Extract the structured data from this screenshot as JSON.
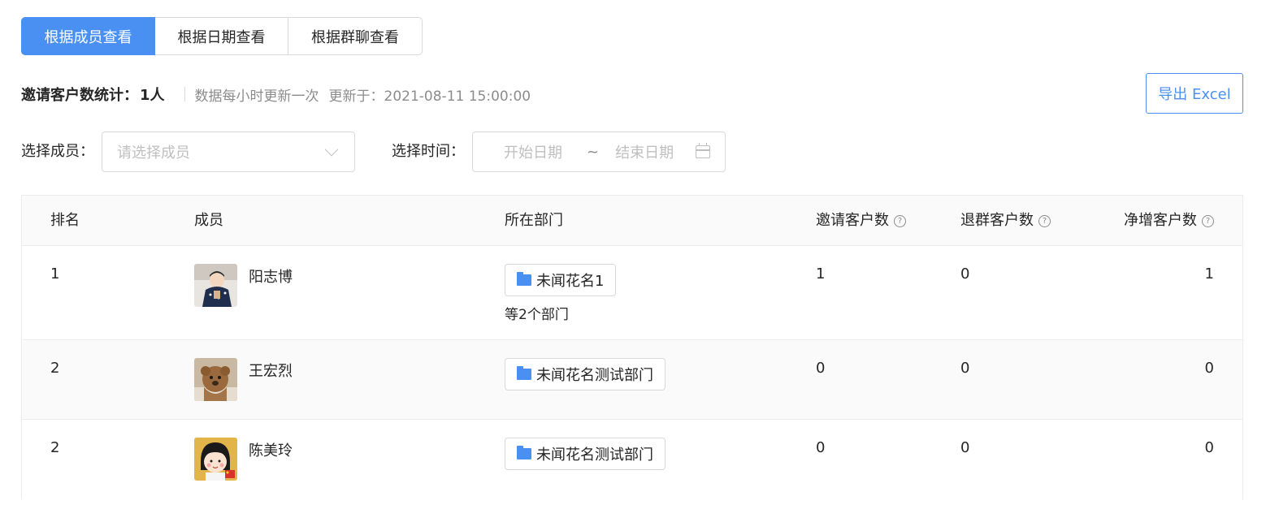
{
  "tabs": [
    {
      "label": "根据成员查看",
      "active": true
    },
    {
      "label": "根据日期查看",
      "active": false
    },
    {
      "label": "根据群聊查看",
      "active": false
    }
  ],
  "stats": {
    "label": "邀请客户数统计：",
    "value": "1人",
    "note": "数据每小时更新一次",
    "updated": "更新于：2021-08-11 15:00:00"
  },
  "export_button": "导出 Excel",
  "filters": {
    "member_label": "选择成员：",
    "member_placeholder": "请选择成员",
    "time_label": "选择时间：",
    "start_placeholder": "开始日期",
    "separator": "~",
    "end_placeholder": "结束日期"
  },
  "table": {
    "headers": {
      "rank": "排名",
      "member": "成员",
      "department": "所在部门",
      "invited": "邀请客户数",
      "left": "退群客户数",
      "net": "净增客户数"
    },
    "rows": [
      {
        "rank": "1",
        "name": "阳志博",
        "department": "未闻花名1",
        "department_more": "等2个部门",
        "invited": "1",
        "left": "0",
        "net": "1"
      },
      {
        "rank": "2",
        "name": "王宏烈",
        "department": "未闻花名测试部门",
        "department_more": "",
        "invited": "0",
        "left": "0",
        "net": "0"
      },
      {
        "rank": "2",
        "name": "陈美玲",
        "department": "未闻花名测试部门",
        "department_more": "",
        "invited": "0",
        "left": "0",
        "net": "0"
      }
    ]
  },
  "colors": {
    "primary": "#4a90f2",
    "border": "#d9d9d9",
    "placeholder": "#bfbfbf",
    "muted": "#8c8c8c"
  },
  "icons": [
    "chevron-down-icon",
    "calendar-icon",
    "help-icon",
    "folder-icon"
  ]
}
